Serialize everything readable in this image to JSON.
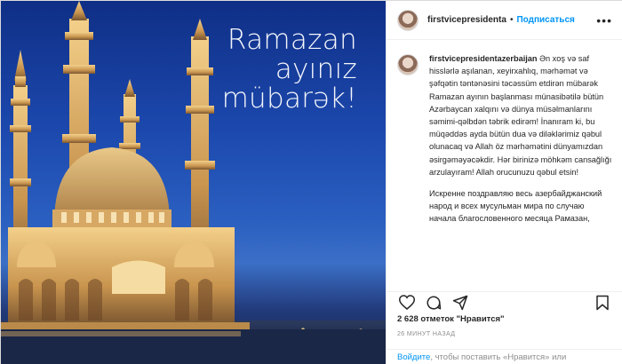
{
  "media": {
    "overlay_lines": [
      "Ramazan",
      "ayınız",
      "mübarək!"
    ]
  },
  "header": {
    "username": "firstvicepresidenta",
    "separator": "•",
    "follow_label": "Подписаться",
    "more_label": "•••"
  },
  "caption": {
    "username": "firstvicepresidentazerbaijan",
    "text_az": "Ən xoş və saf hisslərlə aşılanan, xeyirxahlıq, mərhəmət və şəfqətin təntənəsini təcəssüm etdirən mübarək Ramazan ayının başlanması münasibətilə bütün Azərbaycan xalqını və dünya müsəlmanlarını səmimi-qəlbdən təbrik edirəm! İnanıram ki, bu müqəddəs ayda bütün dua və diləklərimiz qəbul olunacaq və Allah öz mərhəmətini dünyamızdan əsirgəməyəcəkdir. Hər birinizə möhkəm cansağlığı arzulayıram! Allah orucunuzu qəbul etsin!",
    "text_ru": "Искренне поздравляю весь азербайджанский народ и всех мусульман мира по случаю начала благословенного месяца Рамазан,"
  },
  "actions": {
    "like": "heart-icon",
    "comment": "comment-icon",
    "share": "share-icon",
    "save": "bookmark-icon"
  },
  "likes_text": "2 628 отметок \"Нравится\"",
  "timestamp": "26 МИНУТ НАЗАД",
  "login": {
    "link_label": "Войдите",
    "rest": ", чтобы поставить «Нравится» или"
  },
  "colors": {
    "accent": "#0095f6",
    "sky_top": "#0f2f86",
    "sky_mid": "#2a5fc0",
    "mosque_light": "#f2c879"
  }
}
